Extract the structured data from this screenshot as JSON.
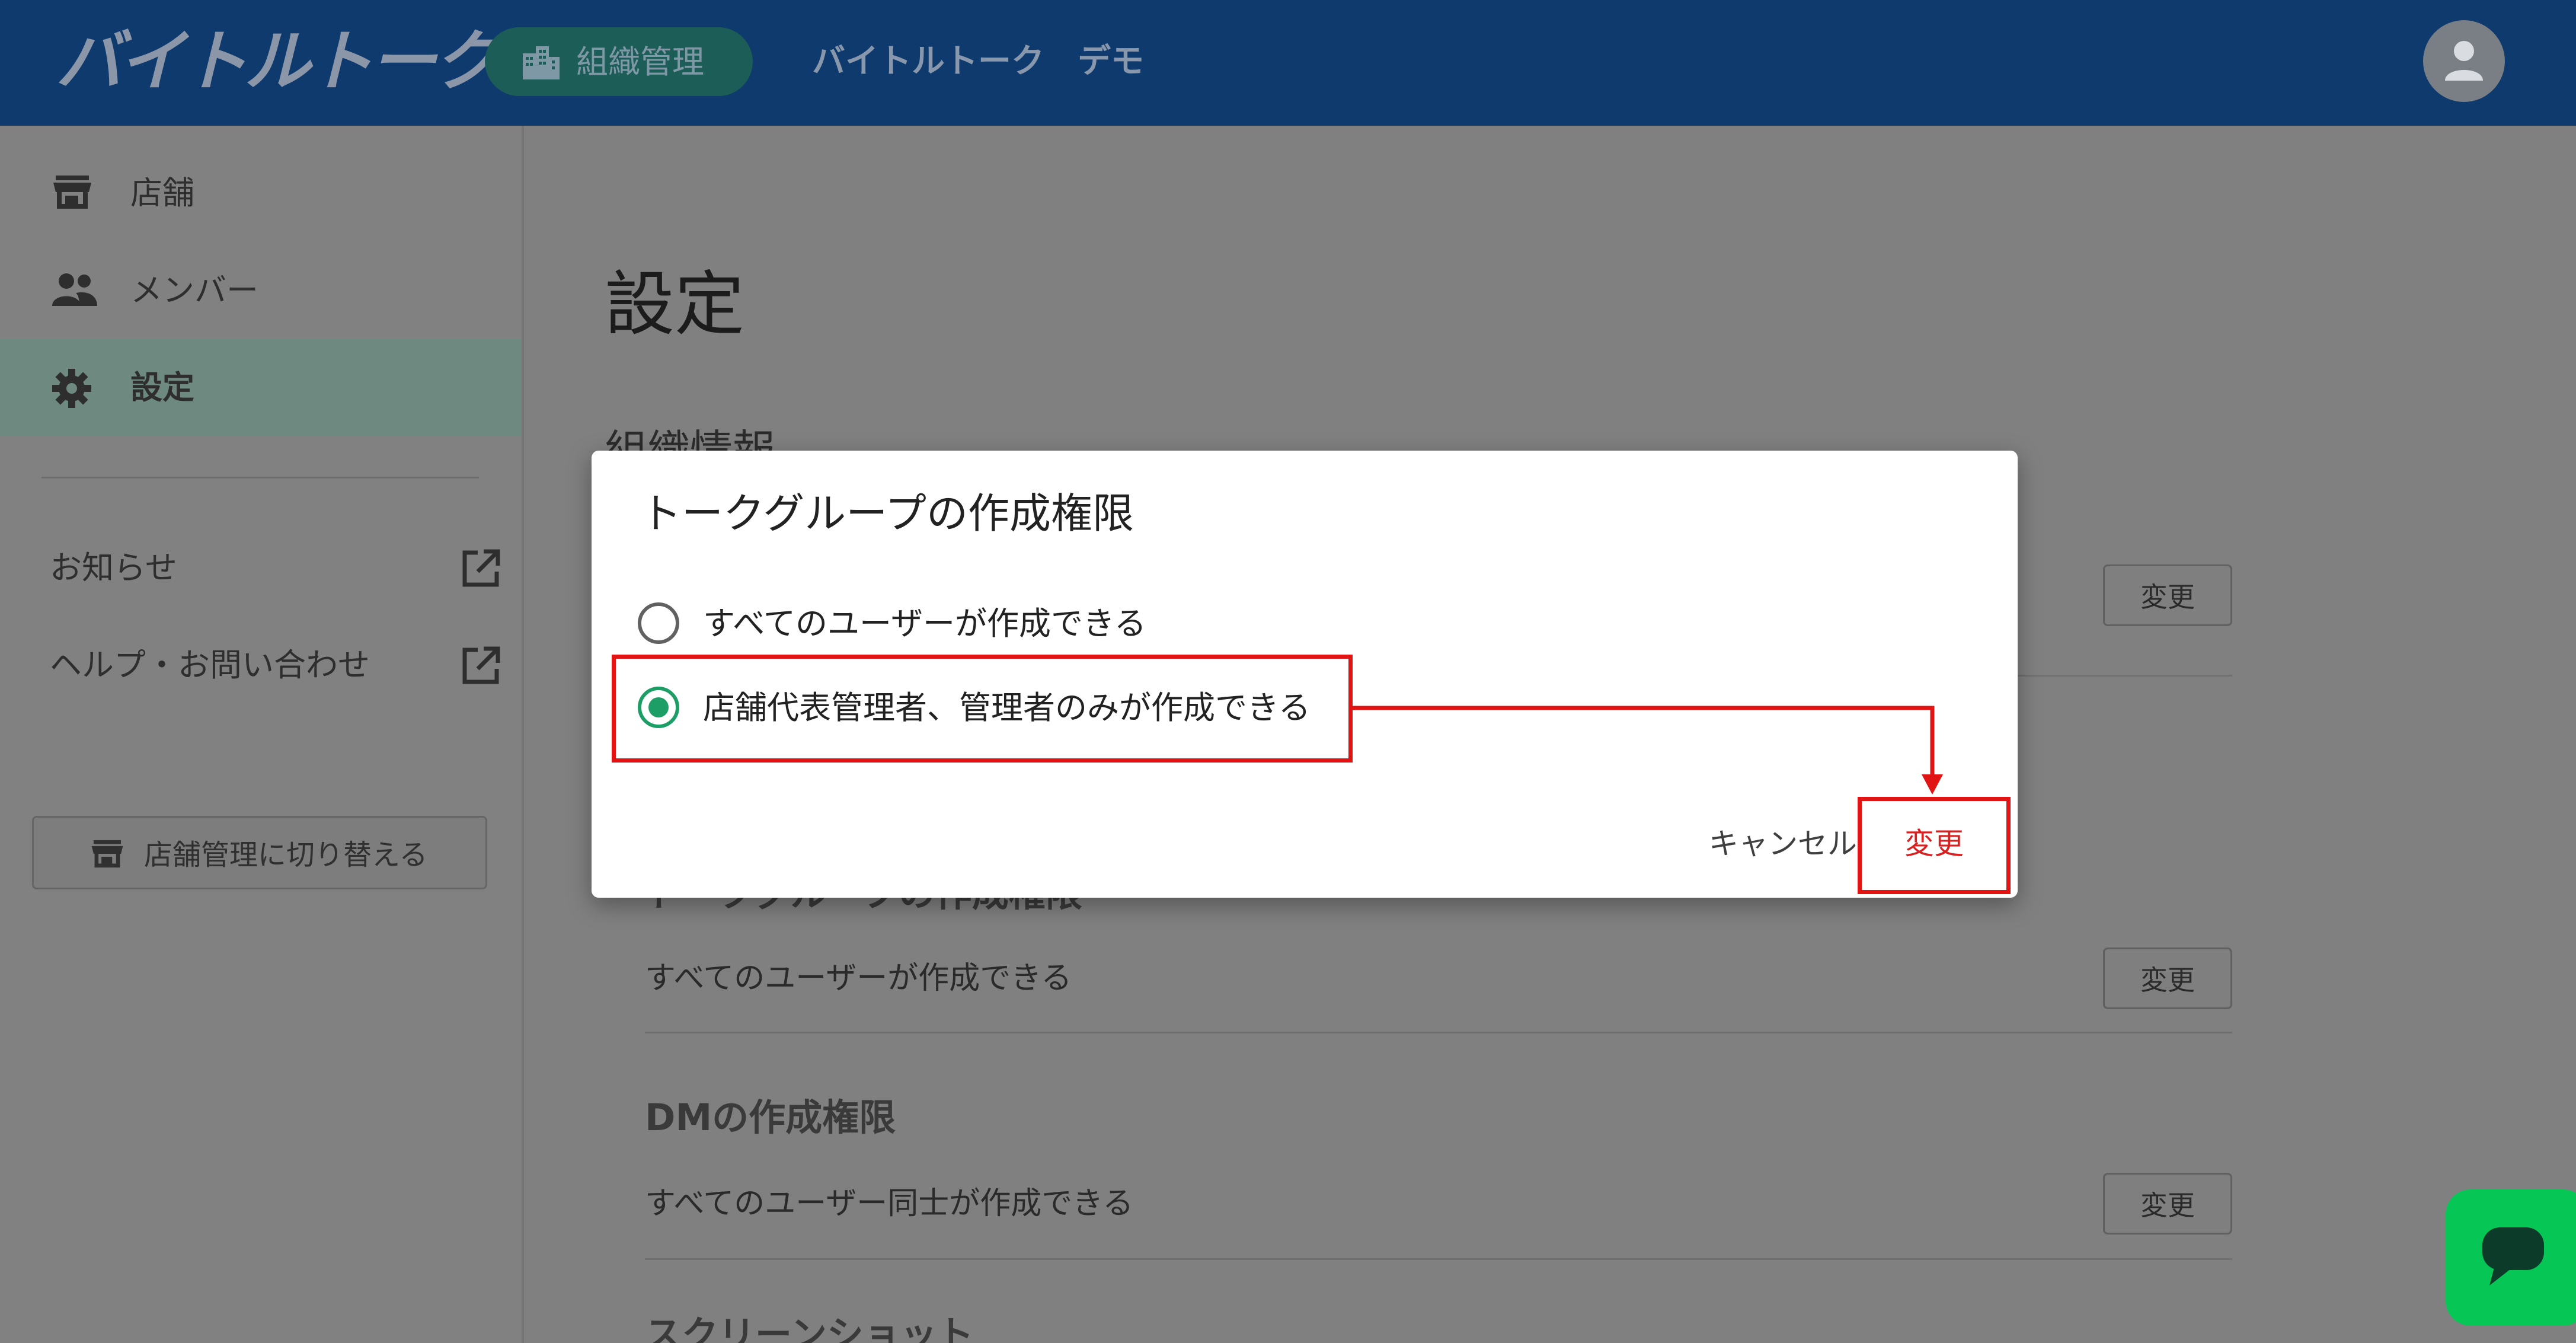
{
  "colors": {
    "header_bg": "#0e3a6d",
    "accent_green": "#1e9e67",
    "highlight_red": "#e11414",
    "chat_green": "#06c755"
  },
  "header": {
    "logo": "バイトルトーク",
    "org_tab_label": "組織管理",
    "org_tab_icon": "building-icon",
    "title": "バイトルトーク　デモ",
    "avatar_icon": "user-icon"
  },
  "sidebar": {
    "items": [
      {
        "label": "店舗",
        "icon": "store-icon"
      },
      {
        "label": "メンバー",
        "icon": "people-icon"
      },
      {
        "label": "設定",
        "icon": "gear-icon",
        "active": true
      }
    ],
    "links": [
      {
        "label": "お知らせ",
        "icon": "external-link-icon"
      },
      {
        "label": "ヘルプ・お問い合わせ",
        "icon": "external-link-icon"
      }
    ],
    "switch_button": "店舗管理に切り替える"
  },
  "main": {
    "page_title": "設定",
    "org_info_heading": "組織情報",
    "sections": [
      {
        "value": "",
        "button": "変更"
      },
      {
        "heading": "トークグループの作成権限",
        "value": "すべてのユーザーが作成できる",
        "button": "変更"
      },
      {
        "heading": "DMの作成権限",
        "value": "すべてのユーザー同士が作成できる",
        "button": "変更"
      },
      {
        "heading": "スクリーンショット"
      }
    ]
  },
  "modal": {
    "title": "トークグループの作成権限",
    "options": [
      {
        "label": "すべてのユーザーが作成できる",
        "selected": false
      },
      {
        "label": "店舗代表管理者、管理者のみが作成できる",
        "selected": true
      }
    ],
    "cancel": "キャンセル",
    "confirm": "変更"
  },
  "chat_fab_icon": "chat-bubble-icon"
}
